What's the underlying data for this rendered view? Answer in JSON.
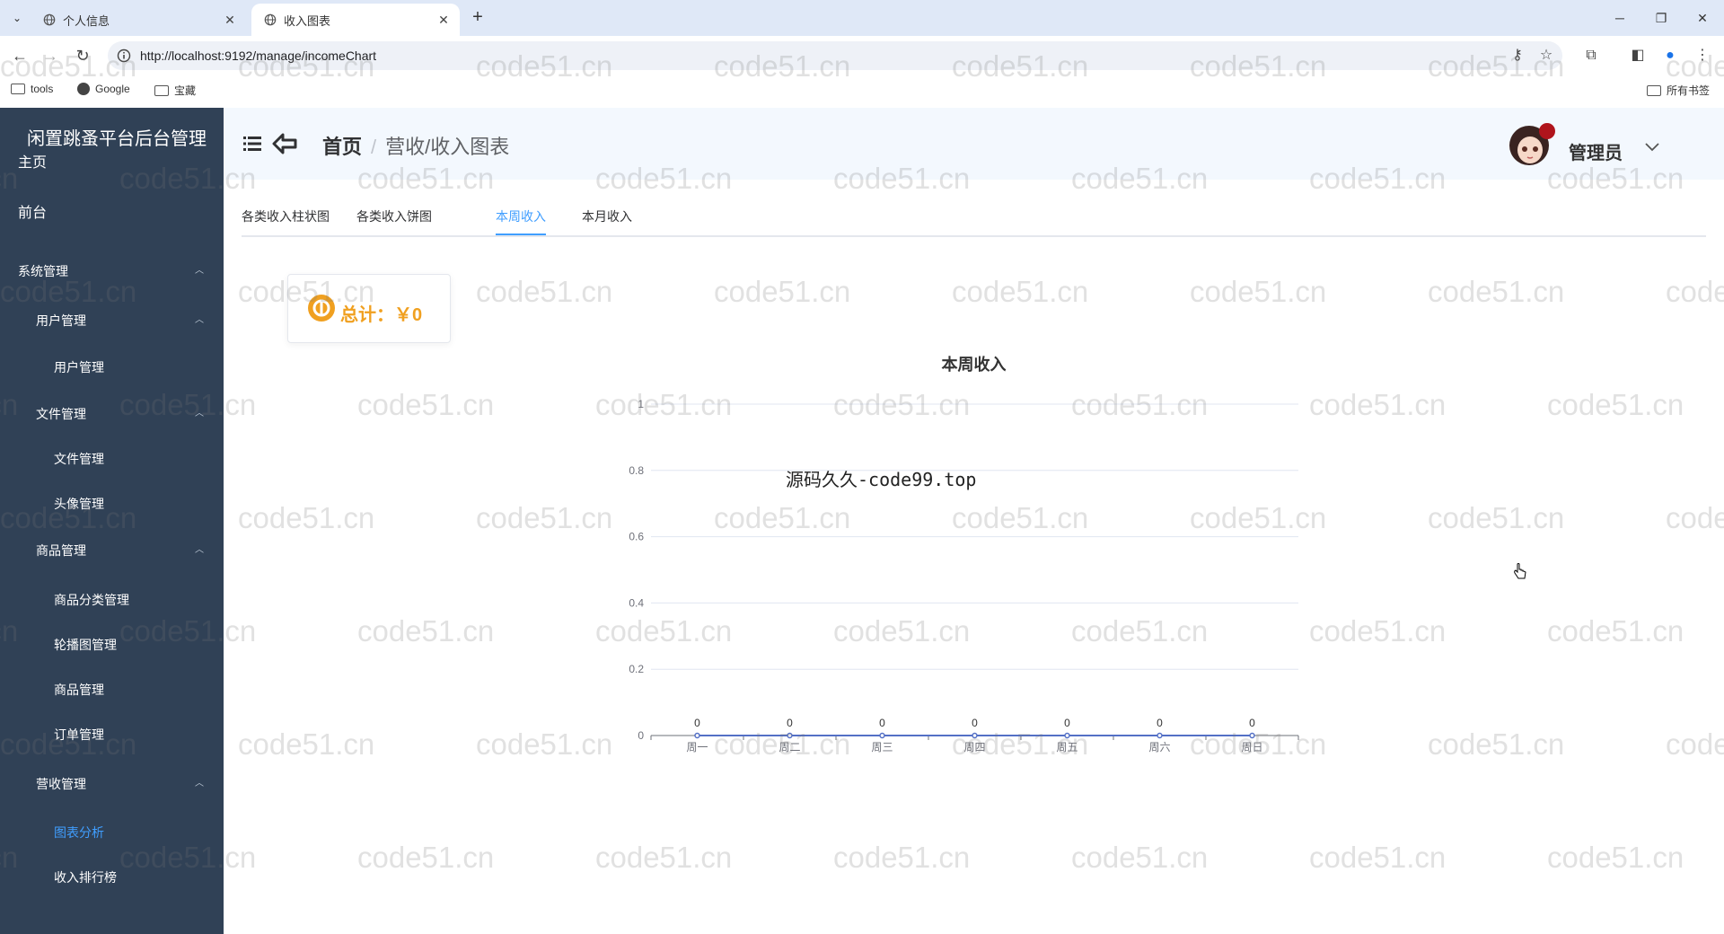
{
  "browser": {
    "tabs": [
      {
        "title": "个人信息",
        "active": false
      },
      {
        "title": "收入图表",
        "active": true
      }
    ],
    "url": "http://localhost:9192/manage/incomeChart",
    "bookmarks": [
      {
        "icon": "folder-icon",
        "label": "tools"
      },
      {
        "icon": "google-icon",
        "label": "Google"
      },
      {
        "icon": "folder-icon",
        "label": "宝藏"
      }
    ],
    "all_bookmarks": "所有书签"
  },
  "app": {
    "brand": "闲置跳蚤平台后台管理",
    "sidebar": [
      {
        "label": "主页",
        "level": 0
      },
      {
        "label": "前台",
        "level": 0
      },
      {
        "label": "系统管理",
        "level": 0,
        "expanded": true
      },
      {
        "label": "用户管理",
        "level": 1,
        "expanded": true
      },
      {
        "label": "用户管理",
        "level": 2
      },
      {
        "label": "文件管理",
        "level": 1,
        "expanded": true
      },
      {
        "label": "文件管理",
        "level": 2
      },
      {
        "label": "头像管理",
        "level": 2
      },
      {
        "label": "商品管理",
        "level": 1,
        "expanded": true
      },
      {
        "label": "商品分类管理",
        "level": 2
      },
      {
        "label": "轮播图管理",
        "level": 2
      },
      {
        "label": "商品管理",
        "level": 2
      },
      {
        "label": "订单管理",
        "level": 2
      },
      {
        "label": "营收管理",
        "level": 1,
        "expanded": true
      },
      {
        "label": "图表分析",
        "level": 2,
        "active": true
      },
      {
        "label": "收入排行榜",
        "level": 2
      }
    ],
    "breadcrumb": {
      "home": "首页",
      "sep": "/",
      "current": "营收/收入图表"
    },
    "user": {
      "name": "管理员"
    },
    "tabs": [
      "各类收入柱状图",
      "各类收入饼图",
      "本周收入",
      "本月收入"
    ],
    "active_tab": 2,
    "total_label": "总计：￥0",
    "overlay_text": "源码久久-code99.top",
    "watermark": "code51.cn"
  },
  "chart_data": {
    "type": "line",
    "title": "本周收入",
    "categories": [
      "周一",
      "周二",
      "周三",
      "周四",
      "周五",
      "周六",
      "周日"
    ],
    "values": [
      0,
      0,
      0,
      0,
      0,
      0,
      0
    ],
    "ylim": [
      0,
      1
    ],
    "yticks": [
      0,
      0.2,
      0.4,
      0.6,
      0.8,
      1
    ],
    "data_labels": true,
    "color": "#5470c6"
  }
}
